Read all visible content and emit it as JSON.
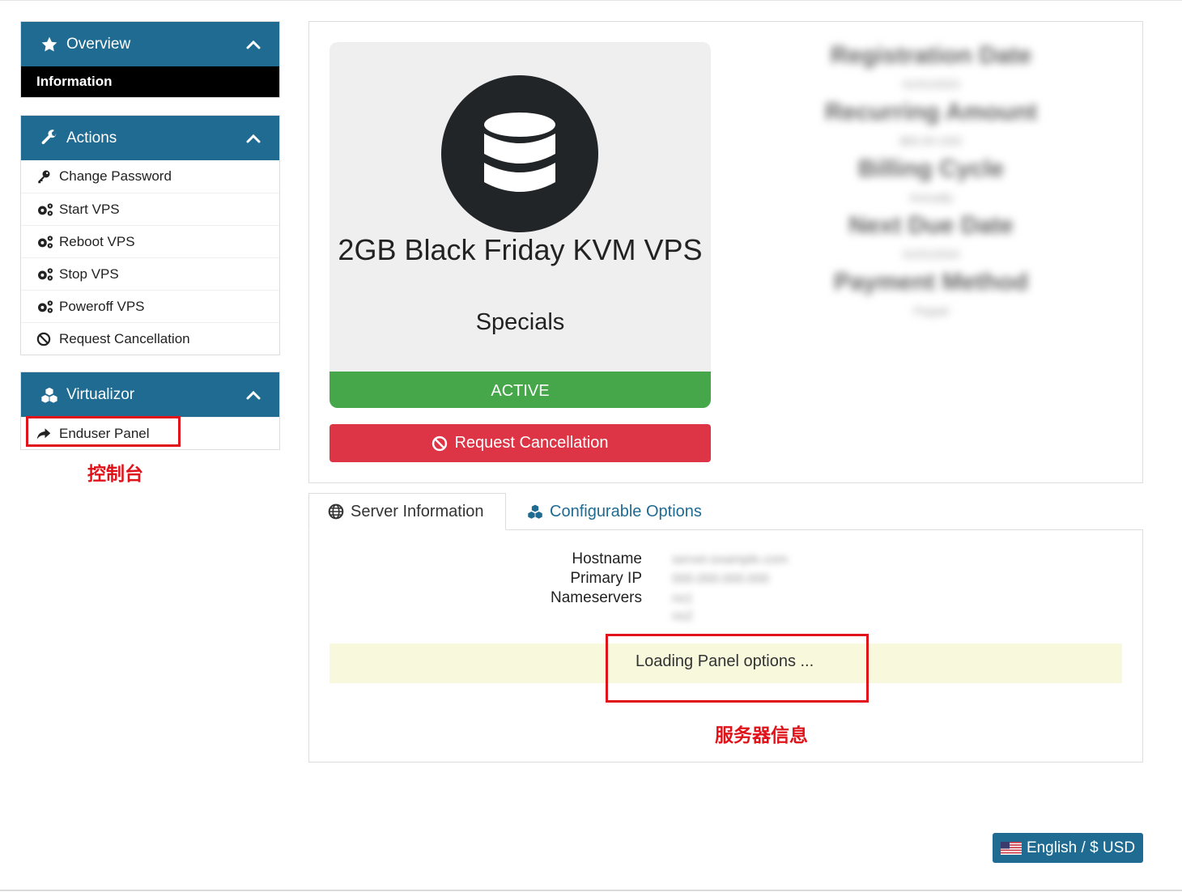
{
  "sidebar": {
    "overview": {
      "title": "Overview",
      "items": [
        {
          "label": "Information"
        }
      ]
    },
    "actions": {
      "title": "Actions",
      "items": [
        {
          "label": "Change Password"
        },
        {
          "label": "Start VPS"
        },
        {
          "label": "Reboot VPS"
        },
        {
          "label": "Stop VPS"
        },
        {
          "label": "Poweroff VPS"
        },
        {
          "label": "Request Cancellation"
        }
      ]
    },
    "virtualizor": {
      "title": "Virtualizor",
      "items": [
        {
          "label": "Enduser Panel"
        }
      ]
    }
  },
  "annotations": {
    "console": "控制台",
    "server_info": "服务器信息"
  },
  "product": {
    "name": "2GB Black Friday KVM VPS",
    "group": "Specials",
    "status": "ACTIVE",
    "cancel_label": "Request Cancellation"
  },
  "details_blurred": [
    {
      "label": "Registration Date",
      "value": "01/01/2023"
    },
    {
      "label": "Recurring Amount",
      "value": "$00.00 USD"
    },
    {
      "label": "Billing Cycle",
      "value": "Annually"
    },
    {
      "label": "Next Due Date",
      "value": "01/01/2024"
    },
    {
      "label": "Payment Method",
      "value": "Paypal"
    }
  ],
  "tabs": {
    "server_info": "Server Information",
    "config_options": "Configurable Options"
  },
  "server": {
    "hostname_label": "Hostname",
    "ip_label": "Primary IP",
    "ns_label": "Nameservers",
    "hostname_value": "server.example.com",
    "ip_value": "000.000.000.000",
    "ns1": "ns1",
    "ns2": "ns2",
    "loading": "Loading Panel options ..."
  },
  "footer": {
    "language": "English / $ USD"
  },
  "colors": {
    "primary": "#1f6b91",
    "success": "#46a64a",
    "danger": "#dd3545",
    "annotation": "#e0131a"
  }
}
